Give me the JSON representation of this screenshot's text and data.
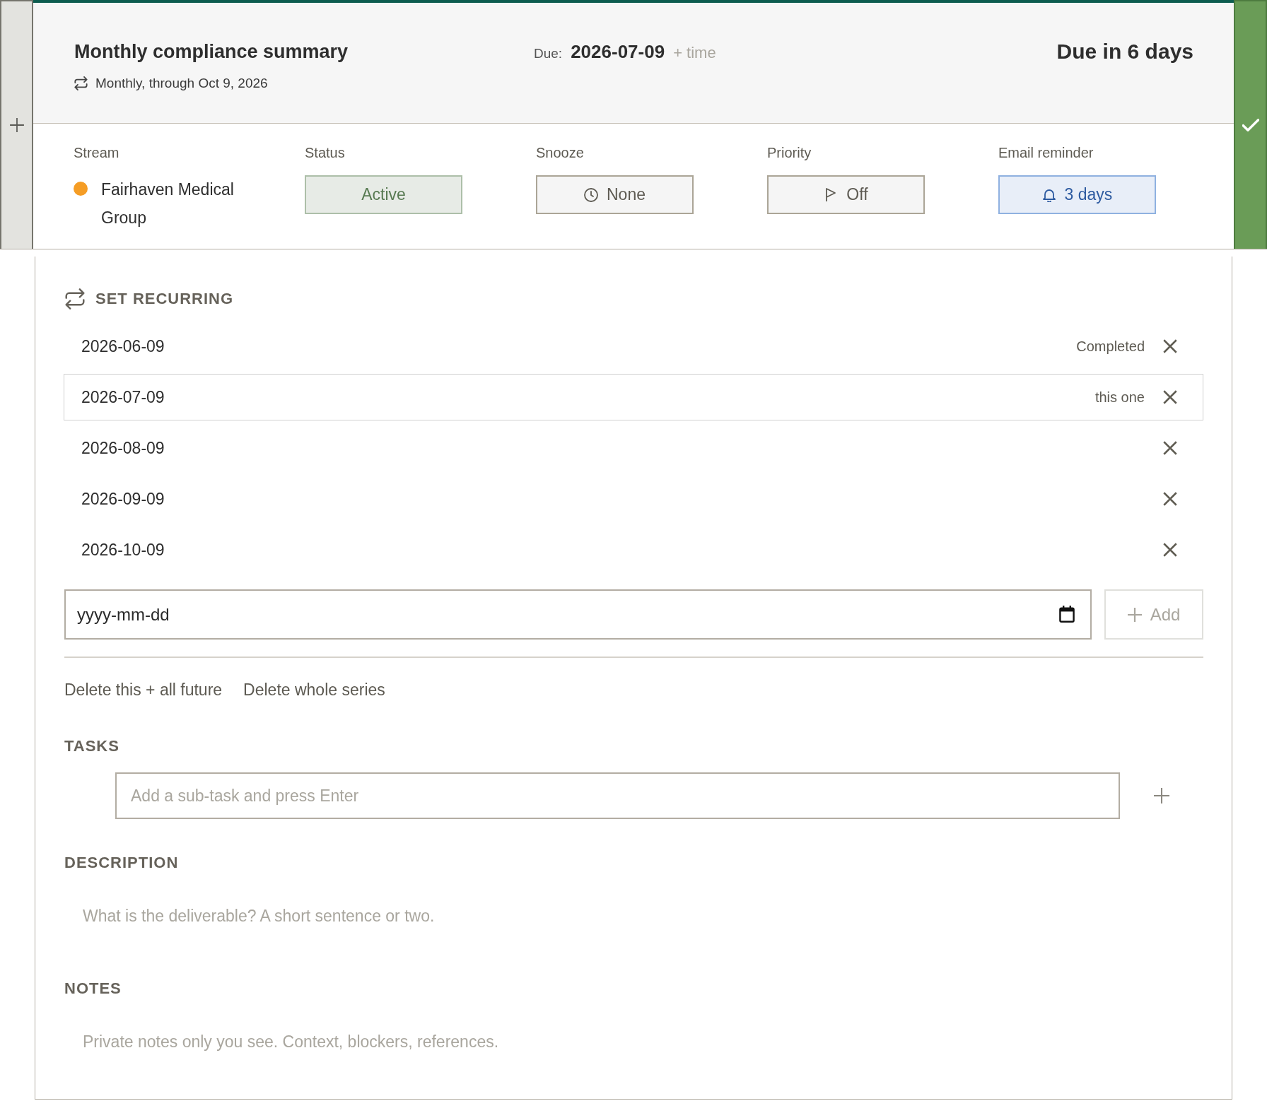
{
  "task": {
    "title": "Monthly compliance summary",
    "recurrence": "Monthly, through Oct 9, 2026",
    "due_label": "Due:",
    "due_date": "2026-07-09",
    "add_time": "+ time",
    "due_in": "Due in 6 days"
  },
  "fields": [
    {
      "kind": "stream",
      "label": "Stream",
      "value": "Fairhaven Medical Group",
      "color": "#f59d25"
    },
    {
      "kind": "status",
      "label": "Status",
      "value": "Active"
    },
    {
      "kind": "snooze",
      "label": "Snooze",
      "value": "None"
    },
    {
      "kind": "priority",
      "label": "Priority",
      "value": "Off"
    },
    {
      "kind": "reminder",
      "label": "Email reminder",
      "value": "3 days"
    }
  ],
  "recurring": {
    "heading": "SET RECURRING",
    "occurrences": [
      {
        "date": "2026-06-09",
        "note": "Completed",
        "selected": false
      },
      {
        "date": "2026-07-09",
        "note": "this one",
        "selected": true
      },
      {
        "date": "2026-08-09",
        "selected": false
      },
      {
        "date": "2026-09-09",
        "selected": false
      },
      {
        "date": "2026-10-09",
        "selected": false
      }
    ],
    "date_input": {
      "placeholder": "yyyy-mm-dd"
    },
    "add_button": "Add",
    "actions": [
      "Delete this + all future",
      "Delete whole series"
    ]
  },
  "tasks": {
    "heading": "TASKS",
    "input": {
      "placeholder": "Add a sub-task and press Enter"
    }
  },
  "description": {
    "heading": "DESCRIPTION",
    "placeholder": "What is the deliverable? A short sentence or two."
  },
  "notes": {
    "heading": "NOTES",
    "placeholder": "Private notes only you see. Context, blockers, references."
  }
}
